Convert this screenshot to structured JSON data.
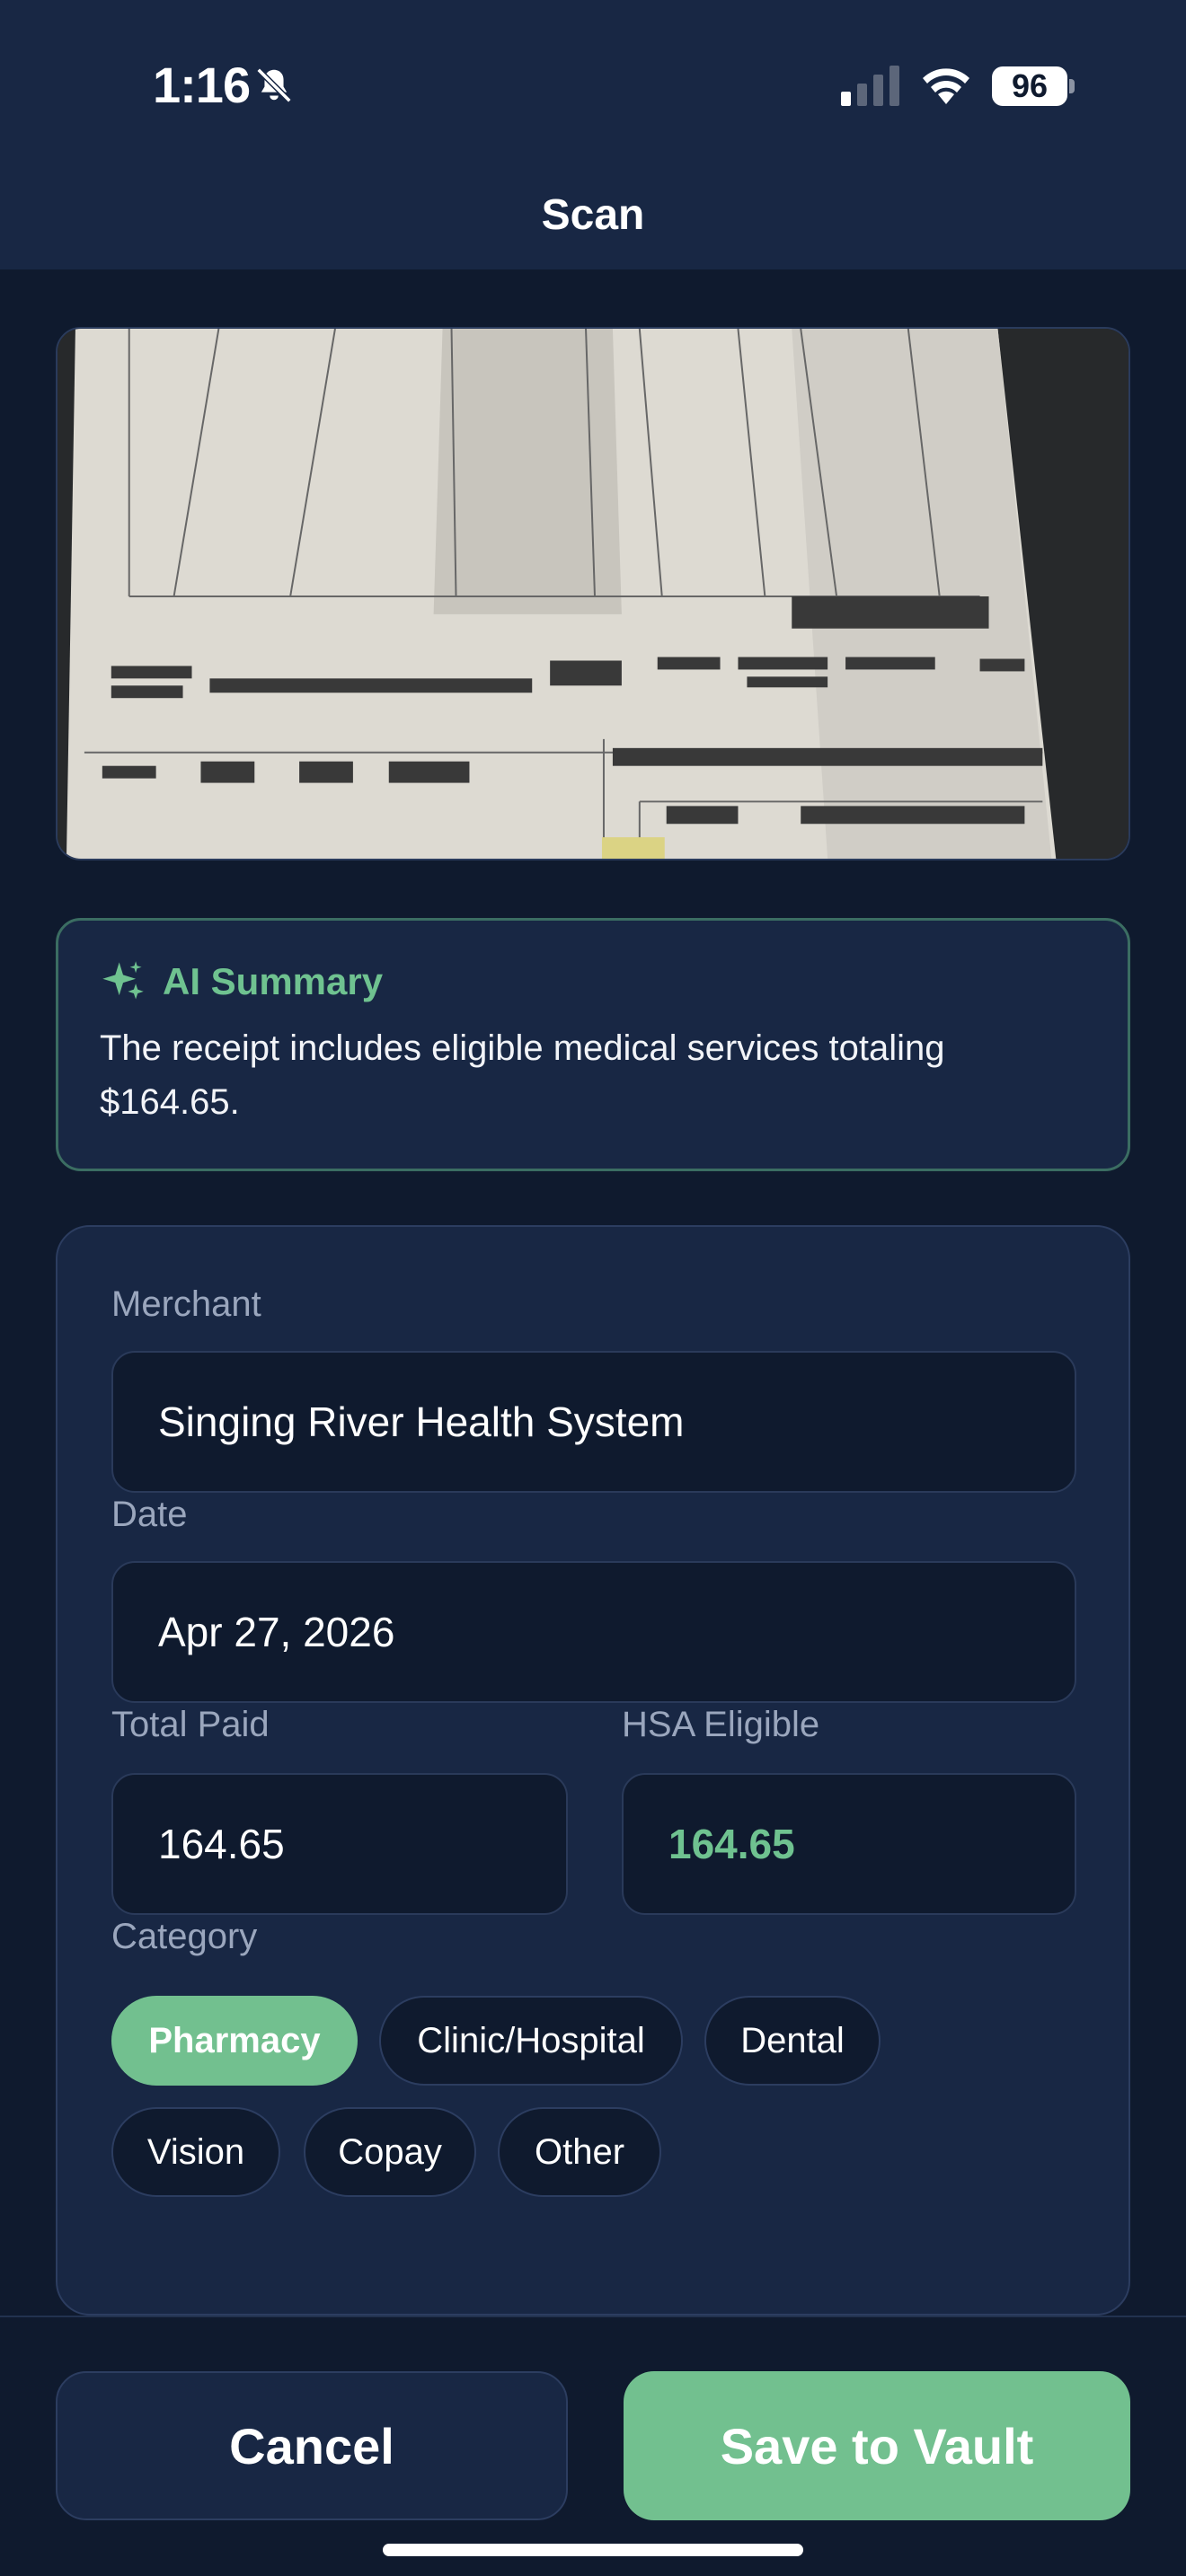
{
  "status_bar": {
    "time": "1:16",
    "battery": "96",
    "icons": [
      "bell-slash-icon",
      "signal-icon",
      "wifi-icon",
      "battery-icon"
    ]
  },
  "header": {
    "title": "Scan"
  },
  "receipt_image": {
    "description_icon": "receipt-photo"
  },
  "summary": {
    "icon": "sparkle-icon",
    "title": "AI Summary",
    "text": "The receipt includes eligible medical services totaling $164.65."
  },
  "form": {
    "merchant_label": "Merchant",
    "merchant_value": "Singing River Health System",
    "date_label": "Date",
    "date_value": "Apr 27, 2026",
    "total_label": "Total Paid",
    "total_value": "164.65",
    "hsa_label": "HSA Eligible",
    "hsa_value": "164.65",
    "category_label": "Category",
    "categories": [
      {
        "label": "Pharmacy",
        "selected": true
      },
      {
        "label": "Clinic/Hospital",
        "selected": false
      },
      {
        "label": "Dental",
        "selected": false
      },
      {
        "label": "Vision",
        "selected": false
      },
      {
        "label": "Copay",
        "selected": false
      },
      {
        "label": "Other",
        "selected": false
      }
    ]
  },
  "actions": {
    "cancel_label": "Cancel",
    "save_label": "Save to Vault"
  },
  "colors": {
    "background": "#0f1a2e",
    "card": "#182744",
    "accent_green": "#72c08f",
    "summary_border": "#3b6d62"
  }
}
